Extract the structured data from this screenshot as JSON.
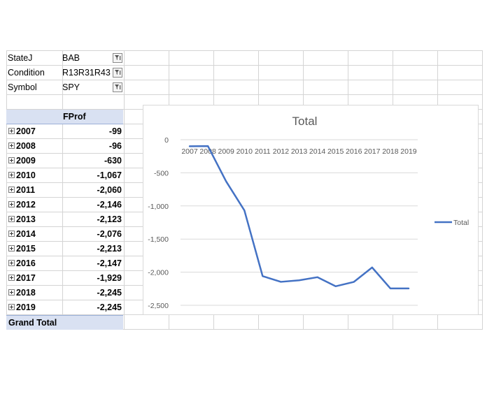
{
  "filters": [
    {
      "label": "StateJ",
      "value": "BAB",
      "icon": "filter-icon"
    },
    {
      "label": "Condition",
      "value": "R13R31R43",
      "icon": "filter-icon"
    },
    {
      "label": "Symbol",
      "value": "SPY",
      "icon": "filter-icon"
    }
  ],
  "pivot": {
    "header": "FProf",
    "rows": [
      {
        "year": "2007",
        "value": "-99"
      },
      {
        "year": "2008",
        "value": "-96"
      },
      {
        "year": "2009",
        "value": "-630"
      },
      {
        "year": "2010",
        "value": "-1,067"
      },
      {
        "year": "2011",
        "value": "-2,060"
      },
      {
        "year": "2012",
        "value": "-2,146"
      },
      {
        "year": "2013",
        "value": "-2,123"
      },
      {
        "year": "2014",
        "value": "-2,076"
      },
      {
        "year": "2015",
        "value": "-2,213"
      },
      {
        "year": "2016",
        "value": "-2,147"
      },
      {
        "year": "2017",
        "value": "-1,929"
      },
      {
        "year": "2018",
        "value": "-2,245"
      },
      {
        "year": "2019",
        "value": "-2,245"
      }
    ],
    "grand_total_label": "Grand Total"
  },
  "colors": {
    "line": "#4472c4",
    "pivot_header": "#d9e1f2",
    "grid": "#d4d4d4"
  },
  "chart_data": {
    "type": "line",
    "title": "Total",
    "categories": [
      "2007",
      "2008",
      "2009",
      "2010",
      "2011",
      "2012",
      "2013",
      "2014",
      "2015",
      "2016",
      "2017",
      "2018",
      "2019"
    ],
    "series": [
      {
        "name": "Total",
        "values": [
          -99,
          -96,
          -630,
          -1067,
          -2060,
          -2146,
          -2123,
          -2076,
          -2213,
          -2147,
          -1929,
          -2245,
          -2245
        ]
      }
    ],
    "yticks": [
      0,
      -500,
      -1000,
      -1500,
      -2000,
      -2500
    ],
    "ytick_labels": [
      "0",
      "-500",
      "-1,000",
      "-1,500",
      "-2,000",
      "-2,500"
    ],
    "ylim": [
      -2500,
      0
    ],
    "xlabel": "",
    "ylabel": "",
    "grid": true,
    "legend": "right",
    "x_axis_position": "top"
  }
}
